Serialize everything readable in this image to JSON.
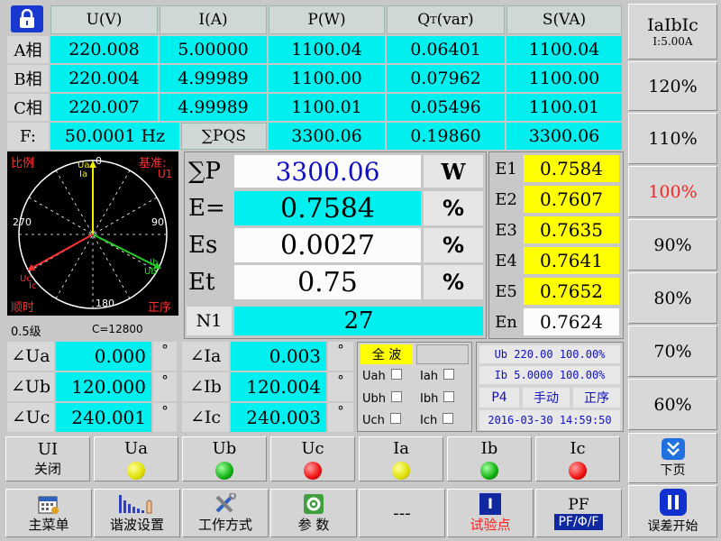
{
  "table": {
    "headers": [
      "U(V)",
      "I(A)",
      "P(W)",
      "S(VA)"
    ],
    "q_header": {
      "main": "Q",
      "sub": "T",
      "unit": "(var)"
    },
    "rows": [
      {
        "label": "A相",
        "u": "220.008",
        "i": "5.00000",
        "p": "1100.04",
        "q": "0.06401",
        "s": "1100.04"
      },
      {
        "label": "B相",
        "u": "220.004",
        "i": "4.99989",
        "p": "1100.00",
        "q": "0.07962",
        "s": "1100.00"
      },
      {
        "label": "C相",
        "u": "220.007",
        "i": "4.99989",
        "p": "1100.01",
        "q": "0.05496",
        "s": "1100.01"
      }
    ],
    "freq_label": "F:",
    "freq_value": "50.0001 Hz",
    "sum_label": "∑PQS",
    "sum_p": "3300.06",
    "sum_q": "0.19860",
    "sum_s": "3300.06"
  },
  "phasor": {
    "scale_label": "比例",
    "ref_label": "基准:",
    "ref_value": "U1",
    "dir_label": "顺时",
    "seq_label": "正序",
    "deg_0": "0",
    "deg_90": "90",
    "deg_180": "180",
    "deg_270": "270",
    "ua_tag": "Ua",
    "ia_tag": "Ia",
    "ub_tag": "Ub",
    "ib_tag": "Ib",
    "uc_tag": "Uc",
    "ic_tag": "Ic",
    "class_label": "0.5级",
    "constant_label": "C=12800"
  },
  "measure": {
    "sum_p_label": "∑P",
    "sum_p_value": "3300.06",
    "sum_p_unit": "W",
    "e_label": "E=",
    "e_value": "0.7584",
    "e_unit": "%",
    "es_label": "Es",
    "es_value": "0.0027",
    "es_unit": "%",
    "et_label": "Et",
    "et_value": "0.75",
    "et_unit": "%",
    "n1_label": "N1",
    "n1_value": "27"
  },
  "errors": [
    {
      "label": "E1",
      "value": "0.7584"
    },
    {
      "label": "E2",
      "value": "0.7607"
    },
    {
      "label": "E3",
      "value": "0.7635"
    },
    {
      "label": "E4",
      "value": "0.7641"
    },
    {
      "label": "E5",
      "value": "0.7652"
    },
    {
      "label": "En",
      "value": "0.7624"
    }
  ],
  "angles": {
    "ua_label": "∠Ua",
    "ua_value": "0.000",
    "ub_label": "∠Ub",
    "ub_value": "120.000",
    "uc_label": "∠Uc",
    "uc_value": "240.001",
    "ia_label": "∠Ia",
    "ia_value": "0.003",
    "ib_label": "∠Ib",
    "ib_value": "120.004",
    "ic_label": "∠Ic",
    "ic_value": "240.003",
    "deg_symbol": "°"
  },
  "harmonic": {
    "full_wave": "全 波",
    "uah": "Uah",
    "iah": "Iah",
    "ubh": "Ubh",
    "ibh": "Ibh",
    "uch": "Uch",
    "ich": "Ich"
  },
  "status": {
    "ub_line": "Ub 220.00 100.00%",
    "ib_line": "Ib 5.0000 100.00%",
    "wiring": "P4",
    "mode": "手动",
    "sequence": "正序",
    "datetime": "2016-03-30 14:59:50"
  },
  "right_panel": {
    "title": "IaIbIc",
    "subtitle": "I:5.00A",
    "levels": [
      "120%",
      "110%",
      "100%",
      "90%",
      "80%",
      "70%",
      "60%"
    ],
    "selected_level_color": "#ff2020",
    "next_page": "下页",
    "start_error": "误差开始"
  },
  "switches": {
    "ui_title": "UI",
    "ui_state": "关闭",
    "ua": "Ua",
    "ub": "Ub",
    "uc": "Uc",
    "ia": "Ia",
    "ib": "Ib",
    "ic": "Ic",
    "lamp_colors": {
      "a": "#f0f000",
      "b": "#10b010",
      "c": "#f01010"
    }
  },
  "bottom": {
    "main_menu": "主菜单",
    "harmonic_setup": "谐波设置",
    "work_mode": "工作方式",
    "params": "参 数",
    "dashes": "---",
    "test_point_icon": "I",
    "test_point": "试验点",
    "pf_title": "PF",
    "pf_sub": "PF/Φ/F"
  },
  "colors": {
    "cyan": "#00f0f0",
    "yellow": "#ffff00",
    "phase_a": "#f0f000",
    "phase_b": "#20d020",
    "phase_c": "#ff3030",
    "blue_text": "#1010c0"
  }
}
